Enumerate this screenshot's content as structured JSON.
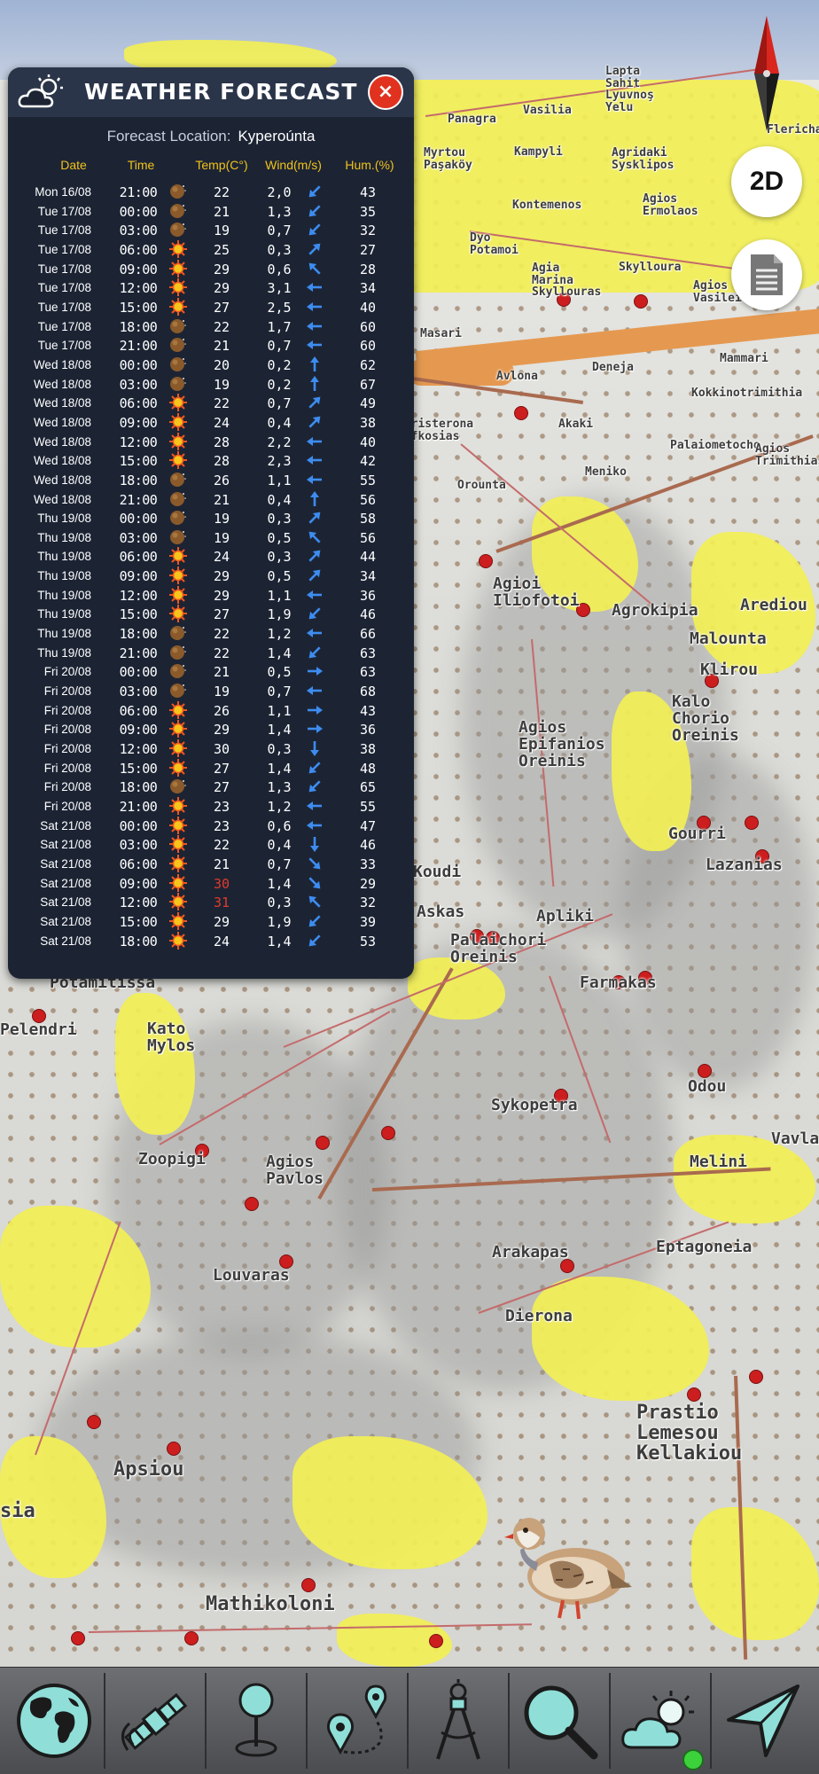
{
  "panel": {
    "title": "WEATHER FORECAST",
    "close_label": "×",
    "location_label": "Forecast Location:",
    "location_value": "Kyperoúnta",
    "headers": {
      "date": "Date",
      "time": "Time",
      "temp": "Temp(C°)",
      "wind": "Wind(m/s)",
      "hum": "Hum.(%)"
    },
    "rows": [
      {
        "date": "Mon 16/08",
        "time": "21:00",
        "icon": "moon",
        "temp": "22",
        "speed": "2,0",
        "dir": "sw",
        "hum": "43"
      },
      {
        "date": "Tue 17/08",
        "time": "00:00",
        "icon": "moon",
        "temp": "21",
        "speed": "1,3",
        "dir": "sw",
        "hum": "35"
      },
      {
        "date": "Tue 17/08",
        "time": "03:00",
        "icon": "moon",
        "temp": "19",
        "speed": "0,7",
        "dir": "sw",
        "hum": "32"
      },
      {
        "date": "Tue 17/08",
        "time": "06:00",
        "icon": "sun",
        "temp": "25",
        "speed": "0,3",
        "dir": "ne",
        "hum": "27"
      },
      {
        "date": "Tue 17/08",
        "time": "09:00",
        "icon": "sun",
        "temp": "29",
        "speed": "0,6",
        "dir": "nw",
        "hum": "28"
      },
      {
        "date": "Tue 17/08",
        "time": "12:00",
        "icon": "sun",
        "temp": "29",
        "speed": "3,1",
        "dir": "w",
        "hum": "34"
      },
      {
        "date": "Tue 17/08",
        "time": "15:00",
        "icon": "sun",
        "temp": "27",
        "speed": "2,5",
        "dir": "w",
        "hum": "40"
      },
      {
        "date": "Tue 17/08",
        "time": "18:00",
        "icon": "moon",
        "temp": "22",
        "speed": "1,7",
        "dir": "w",
        "hum": "60"
      },
      {
        "date": "Tue 17/08",
        "time": "21:00",
        "icon": "moon",
        "temp": "21",
        "speed": "0,7",
        "dir": "w",
        "hum": "60"
      },
      {
        "date": "Wed 18/08",
        "time": "00:00",
        "icon": "moon",
        "temp": "20",
        "speed": "0,2",
        "dir": "n",
        "hum": "62"
      },
      {
        "date": "Wed 18/08",
        "time": "03:00",
        "icon": "moon",
        "temp": "19",
        "speed": "0,2",
        "dir": "n",
        "hum": "67"
      },
      {
        "date": "Wed 18/08",
        "time": "06:00",
        "icon": "sun",
        "temp": "22",
        "speed": "0,7",
        "dir": "ne",
        "hum": "49"
      },
      {
        "date": "Wed 18/08",
        "time": "09:00",
        "icon": "sun",
        "temp": "24",
        "speed": "0,4",
        "dir": "ne",
        "hum": "38"
      },
      {
        "date": "Wed 18/08",
        "time": "12:00",
        "icon": "sun",
        "temp": "28",
        "speed": "2,2",
        "dir": "w",
        "hum": "40"
      },
      {
        "date": "Wed 18/08",
        "time": "15:00",
        "icon": "sun",
        "temp": "28",
        "speed": "2,3",
        "dir": "w",
        "hum": "42"
      },
      {
        "date": "Wed 18/08",
        "time": "18:00",
        "icon": "moon",
        "temp": "26",
        "speed": "1,1",
        "dir": "w",
        "hum": "55"
      },
      {
        "date": "Wed 18/08",
        "time": "21:00",
        "icon": "moon",
        "temp": "21",
        "speed": "0,4",
        "dir": "n",
        "hum": "56"
      },
      {
        "date": "Thu 19/08",
        "time": "00:00",
        "icon": "moon",
        "temp": "19",
        "speed": "0,3",
        "dir": "ne",
        "hum": "58"
      },
      {
        "date": "Thu 19/08",
        "time": "03:00",
        "icon": "moon",
        "temp": "19",
        "speed": "0,5",
        "dir": "nw",
        "hum": "56"
      },
      {
        "date": "Thu 19/08",
        "time": "06:00",
        "icon": "sun",
        "temp": "24",
        "speed": "0,3",
        "dir": "ne",
        "hum": "44"
      },
      {
        "date": "Thu 19/08",
        "time": "09:00",
        "icon": "sun",
        "temp": "29",
        "speed": "0,5",
        "dir": "ne",
        "hum": "34"
      },
      {
        "date": "Thu 19/08",
        "time": "12:00",
        "icon": "sun",
        "temp": "29",
        "speed": "1,1",
        "dir": "w",
        "hum": "36"
      },
      {
        "date": "Thu 19/08",
        "time": "15:00",
        "icon": "sun",
        "temp": "27",
        "speed": "1,9",
        "dir": "sw",
        "hum": "46"
      },
      {
        "date": "Thu 19/08",
        "time": "18:00",
        "icon": "moon",
        "temp": "22",
        "speed": "1,2",
        "dir": "w",
        "hum": "66"
      },
      {
        "date": "Thu 19/08",
        "time": "21:00",
        "icon": "moon",
        "temp": "22",
        "speed": "1,4",
        "dir": "sw",
        "hum": "63"
      },
      {
        "date": "Fri 20/08",
        "time": "00:00",
        "icon": "moon",
        "temp": "21",
        "speed": "0,5",
        "dir": "e",
        "hum": "63"
      },
      {
        "date": "Fri 20/08",
        "time": "03:00",
        "icon": "moon",
        "temp": "19",
        "speed": "0,7",
        "dir": "w",
        "hum": "68"
      },
      {
        "date": "Fri 20/08",
        "time": "06:00",
        "icon": "sun",
        "temp": "26",
        "speed": "1,1",
        "dir": "e",
        "hum": "43"
      },
      {
        "date": "Fri 20/08",
        "time": "09:00",
        "icon": "sun",
        "temp": "29",
        "speed": "1,4",
        "dir": "e",
        "hum": "36"
      },
      {
        "date": "Fri 20/08",
        "time": "12:00",
        "icon": "sun",
        "temp": "30",
        "speed": "0,3",
        "dir": "s",
        "hum": "38"
      },
      {
        "date": "Fri 20/08",
        "time": "15:00",
        "icon": "sun",
        "temp": "27",
        "speed": "1,4",
        "dir": "sw",
        "hum": "48"
      },
      {
        "date": "Fri 20/08",
        "time": "18:00",
        "icon": "moon",
        "temp": "27",
        "speed": "1,3",
        "dir": "sw",
        "hum": "65"
      },
      {
        "date": "Fri 20/08",
        "time": "21:00",
        "icon": "sun",
        "temp": "23",
        "speed": "1,2",
        "dir": "w",
        "hum": "55"
      },
      {
        "date": "Sat 21/08",
        "time": "00:00",
        "icon": "sun",
        "temp": "23",
        "speed": "0,6",
        "dir": "w",
        "hum": "47"
      },
      {
        "date": "Sat 21/08",
        "time": "03:00",
        "icon": "sun",
        "temp": "22",
        "speed": "0,4",
        "dir": "s",
        "hum": "46"
      },
      {
        "date": "Sat 21/08",
        "time": "06:00",
        "icon": "sun",
        "temp": "21",
        "speed": "0,7",
        "dir": "se",
        "hum": "33"
      },
      {
        "date": "Sat 21/08",
        "time": "09:00",
        "icon": "sun",
        "temp": "30",
        "speed": "1,4",
        "dir": "se",
        "hum": "29",
        "hot": true
      },
      {
        "date": "Sat 21/08",
        "time": "12:00",
        "icon": "sun",
        "temp": "31",
        "speed": "0,3",
        "dir": "nw",
        "hum": "32",
        "hot": true
      },
      {
        "date": "Sat 21/08",
        "time": "15:00",
        "icon": "sun",
        "temp": "29",
        "speed": "1,9",
        "dir": "sw",
        "hum": "39"
      },
      {
        "date": "Sat 21/08",
        "time": "18:00",
        "icon": "sun",
        "temp": "24",
        "speed": "1,4",
        "dir": "sw",
        "hum": "53"
      }
    ]
  },
  "controls": {
    "mode_2d": "2D"
  },
  "map": {
    "places": [
      {
        "name": "Lapta\nSahit\nLyuvnoş\nYelu",
        "size": "s"
      },
      {
        "name": "Vasilia",
        "size": "s"
      },
      {
        "name": "Panagra",
        "size": "s"
      },
      {
        "name": "Myrtou\nPaşaköy",
        "size": "s"
      },
      {
        "name": "Kampyli",
        "size": "s"
      },
      {
        "name": "Agridaki\nSysklipos",
        "size": "s"
      },
      {
        "name": "Kontemenos",
        "size": "s"
      },
      {
        "name": "Agios\nErmolaos",
        "size": "s"
      },
      {
        "name": "Flericha",
        "size": "s"
      },
      {
        "name": "Dyo\nPotamoi",
        "size": "s"
      },
      {
        "name": "Agia\nMarina\nSkyllouras",
        "size": "s"
      },
      {
        "name": "Skylloura",
        "size": "s"
      },
      {
        "name": "Agios\nVasileios",
        "size": "s"
      },
      {
        "name": "Masari",
        "size": "s"
      },
      {
        "name": "Deneja",
        "size": "s"
      },
      {
        "name": "Mammari",
        "size": "s"
      },
      {
        "name": "Kokkinotrimithia",
        "size": "s"
      },
      {
        "name": "Avlona",
        "size": "s"
      },
      {
        "name": "Peristerona\nLefkosias",
        "size": "s"
      },
      {
        "name": "Akaki",
        "size": "s"
      },
      {
        "name": "Palaiometocho",
        "size": "s"
      },
      {
        "name": "Agios\nTrimithias",
        "size": "s"
      },
      {
        "name": "Meniko",
        "size": "s"
      },
      {
        "name": "Orounta",
        "size": "s"
      },
      {
        "name": "Agioi\nIliofotoi",
        "size": "m"
      },
      {
        "name": "Agrokipia",
        "size": "m"
      },
      {
        "name": "Arediou",
        "size": "m"
      },
      {
        "name": "Malounta",
        "size": "m"
      },
      {
        "name": "Klirou",
        "size": "m"
      },
      {
        "name": "Kalo\nChorio\nOreinis",
        "size": "m"
      },
      {
        "name": "Agios\nEpifanios\nOreinis",
        "size": "m"
      },
      {
        "name": "Gourri",
        "size": "m"
      },
      {
        "name": "Lazanias",
        "size": "m"
      },
      {
        "name": "Koudi",
        "size": "m"
      },
      {
        "name": "Askas",
        "size": "m"
      },
      {
        "name": "Apliki",
        "size": "m"
      },
      {
        "name": "Palaichori\nOreinis",
        "size": "m"
      },
      {
        "name": "Farmakas",
        "size": "m"
      },
      {
        "name": "Potamitissa",
        "size": "m"
      },
      {
        "name": "Kato\nMylos",
        "size": "m"
      },
      {
        "name": "Pelendri",
        "size": "m"
      },
      {
        "name": "Odou",
        "size": "m"
      },
      {
        "name": "Sykopetra",
        "size": "m"
      },
      {
        "name": "Vavla",
        "size": "m"
      },
      {
        "name": "Zoopigi",
        "size": "m"
      },
      {
        "name": "Agios\nPavlos",
        "size": "m"
      },
      {
        "name": "Melini",
        "size": "m"
      },
      {
        "name": "Arakapas",
        "size": "m"
      },
      {
        "name": "Eptagoneia",
        "size": "m"
      },
      {
        "name": "Louvaras",
        "size": "m"
      },
      {
        "name": "Dierona",
        "size": "m"
      },
      {
        "name": "Prastio\nLemesou\nKellakiou",
        "size": "l"
      },
      {
        "name": "Apsiou",
        "size": "l"
      },
      {
        "name": "Mathikoloni",
        "size": "l"
      },
      {
        "name": "sia",
        "size": "l"
      }
    ]
  },
  "toolbar": {
    "buttons": [
      "globe-icon",
      "satellite-icon",
      "pin-icon",
      "route-icon",
      "compass-tool-icon",
      "search-icon",
      "weather-icon",
      "navigate-icon"
    ]
  },
  "colors": {
    "panel_bg": "#1c2434",
    "header_gold": "#f2c21a",
    "hot_red": "#e23a2b",
    "wind_arrow": "#3d8cf0",
    "map_yellow": "#f2ef55",
    "town_red": "#cc1e1e"
  }
}
